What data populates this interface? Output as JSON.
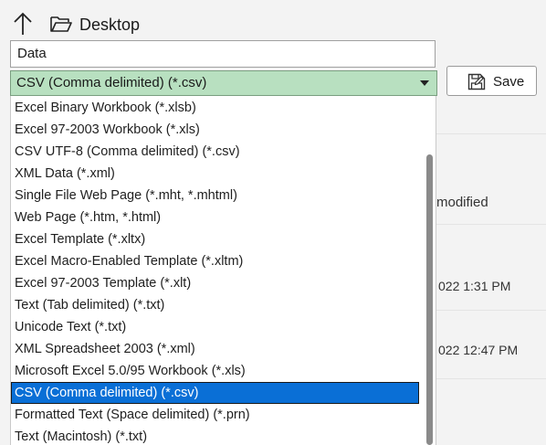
{
  "header": {
    "location": "Desktop",
    "up_icon": "up-arrow-icon",
    "folder_icon": "folder-open-icon"
  },
  "filename": {
    "value": "Data"
  },
  "filetype": {
    "selected": "CSV (Comma delimited) (*.csv)",
    "options": [
      "Excel Binary Workbook (*.xlsb)",
      "Excel 97-2003 Workbook (*.xls)",
      "CSV UTF-8 (Comma delimited) (*.csv)",
      "XML Data (*.xml)",
      "Single File Web Page (*.mht, *.mhtml)",
      "Web Page (*.htm, *.html)",
      "Excel Template (*.xltx)",
      "Excel Macro-Enabled Template (*.xltm)",
      "Excel 97-2003 Template (*.xlt)",
      "Text (Tab delimited) (*.txt)",
      "Unicode Text (*.txt)",
      "XML Spreadsheet 2003 (*.xml)",
      "Microsoft Excel 5.0/95 Workbook (*.xls)",
      "CSV (Comma delimited) (*.csv)",
      "Formatted Text (Space delimited) (*.prn)",
      "Text (Macintosh) (*.txt)"
    ],
    "highlighted_index": 13
  },
  "save_button": {
    "label": "Save",
    "icon": "save-icon"
  },
  "background_list": {
    "column_header": "modified",
    "dates": [
      "022 1:31 PM",
      "022 12:47 PM"
    ]
  },
  "colors": {
    "select_bg": "#b8e0c0",
    "highlight": "#0a6fd6"
  }
}
